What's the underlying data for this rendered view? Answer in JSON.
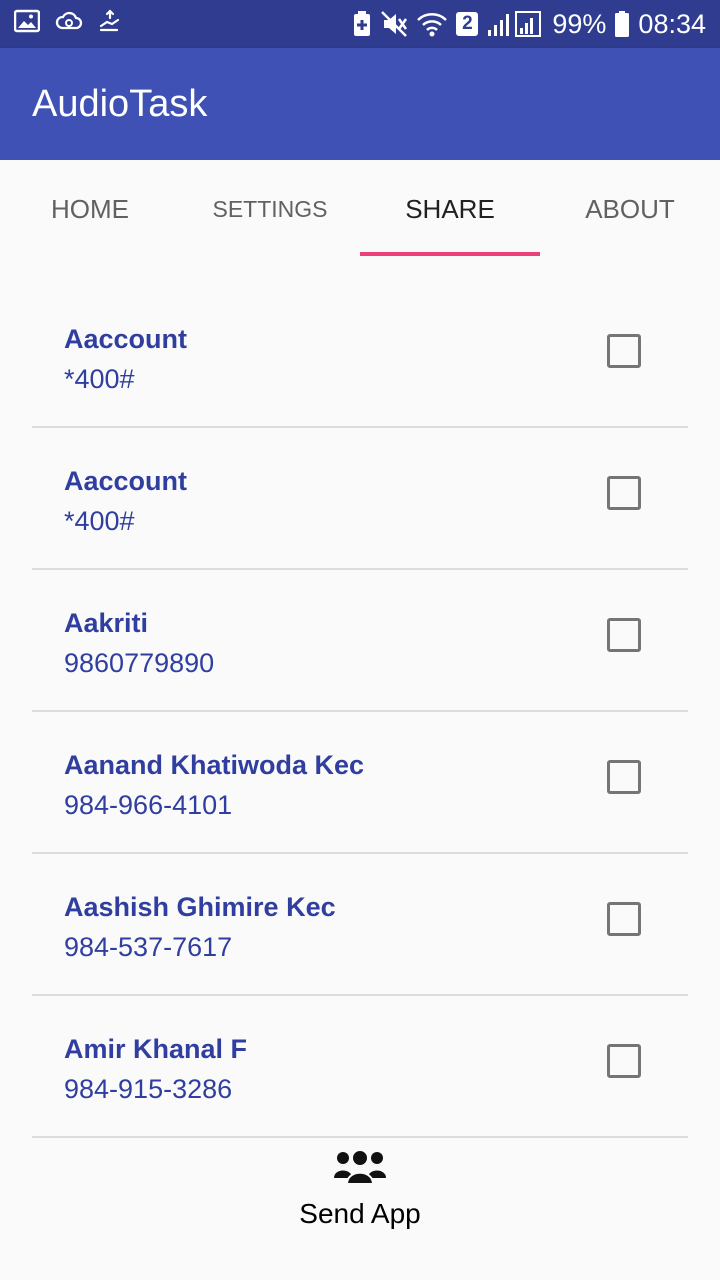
{
  "status_bar": {
    "battery_percent": "99%",
    "time": "08:34",
    "sim_badge": "2",
    "icons": [
      "gallery-icon",
      "cloud-sync-icon",
      "hand-icon",
      "battery-saver-icon",
      "mute-icon",
      "wifi-icon",
      "signal-icon",
      "battery-icon"
    ]
  },
  "app_bar": {
    "title": "AudioTask"
  },
  "tabs": [
    {
      "label": "HOME"
    },
    {
      "label": "SETTINGS"
    },
    {
      "label": "SHARE"
    },
    {
      "label": "ABOUT"
    }
  ],
  "contacts": [
    {
      "name": "Aaccount",
      "phone": "*400#"
    },
    {
      "name": "Aaccount",
      "phone": "*400#"
    },
    {
      "name": "Aakriti",
      "phone": "9860779890"
    },
    {
      "name": "Aanand Khatiwoda Kec",
      "phone": "984-966-4101"
    },
    {
      "name": "Aashish Ghimire Kec",
      "phone": "984-537-7617"
    },
    {
      "name": "Amir Khanal F",
      "phone": "984-915-3286"
    }
  ],
  "send_app": {
    "label": "Send App",
    "icon": "group-icon"
  },
  "colors": {
    "status_bar": "#2f3c8f",
    "app_bar": "#3f51b5",
    "accent": "#ec407a",
    "contact_text": "#303f9f"
  }
}
